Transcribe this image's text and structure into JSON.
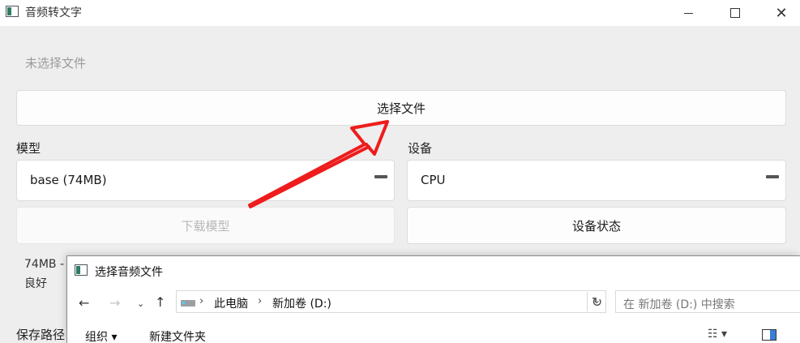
{
  "window": {
    "title": "音频转文字",
    "close_glyph": "✕"
  },
  "main": {
    "no_file_text": "未选择文件",
    "select_file_button": "选择文件",
    "model_label": "模型",
    "model_value": "base (74MB)",
    "device_label": "设备",
    "device_value": "CPU",
    "download_model_button": "下载模型",
    "device_status_button": "设备状态",
    "info_line1": "74MB -",
    "info_line2": "良好",
    "save_path_label": "保存路径"
  },
  "dialog": {
    "title": "选择音频文件",
    "nav": {
      "back_glyph": "←",
      "forward_glyph": "→",
      "recent_glyph": "⌄",
      "up_glyph": "↑",
      "refresh_glyph": "↻"
    },
    "breadcrumb": [
      "此电脑",
      "新加卷 (D:)"
    ],
    "breadcrumb_separator": "›",
    "address_dropdown_glyph": "⌄",
    "search_placeholder": "在 新加卷 (D:) 中搜索",
    "toolbar": {
      "organize": "组织 ▾",
      "new_folder": "新建文件夹",
      "view_menu": "☷ ▾"
    }
  },
  "annotation": {
    "arrow_color": "#ee1c1c"
  }
}
